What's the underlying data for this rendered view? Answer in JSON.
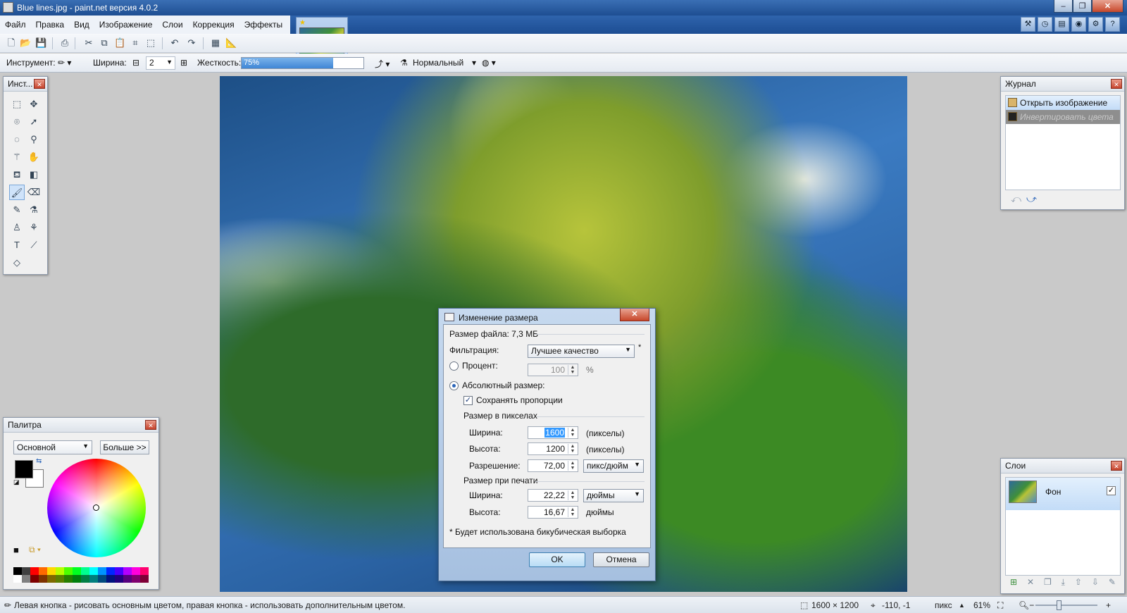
{
  "window": {
    "title": "Blue lines.jpg - paint.net версия 4.0.2",
    "controls": [
      "–",
      "❐",
      "✕"
    ]
  },
  "menu": [
    "Файл",
    "Правка",
    "Вид",
    "Изображение",
    "Слои",
    "Коррекция",
    "Эффекты"
  ],
  "toolbar": {
    "tool_label": "Инструмент:",
    "width_label": "Ширина:",
    "width_value": "2",
    "hardness_label": "Жесткость:",
    "hardness_value": "75%",
    "hardness_fraction": 0.75,
    "blend_mode": "Нормальный"
  },
  "tools_panel": {
    "title": "Инст...",
    "tools": [
      "rectangle-select-icon",
      "move-selection-icon",
      "lasso-icon",
      "move-selected-icon",
      "ellipse-select-icon",
      "zoom-icon",
      "magic-wand-icon",
      "pan-icon",
      "paint-bucket-icon",
      "gradient-icon",
      "paintbrush-icon",
      "eraser-icon",
      "pencil-icon",
      "color-picker-icon",
      "clone-stamp-icon",
      "recolor-icon",
      "text-icon",
      "line-curve-icon",
      "shapes-icon"
    ],
    "active_index": 10
  },
  "history": {
    "title": "Журнал",
    "items": [
      {
        "label": "Открыть изображение",
        "state": "selected"
      },
      {
        "label": "Инвертировать цвета",
        "state": "undone"
      }
    ]
  },
  "layers": {
    "title": "Слои",
    "items": [
      {
        "name": "Фон",
        "visible": true
      }
    ]
  },
  "palette": {
    "title": "Палитра",
    "mode": "Основной",
    "more_button": "Больше >>",
    "primary_color": "#000000",
    "secondary_color": "#ffffff",
    "colors": [
      "#000000",
      "#404040",
      "#ff0000",
      "#ff6a00",
      "#ffd800",
      "#b6ff00",
      "#4cff00",
      "#00ff21",
      "#00ff90",
      "#00ffff",
      "#0094ff",
      "#0026ff",
      "#4800ff",
      "#b200ff",
      "#ff00dc",
      "#ff006e",
      "#ffffff",
      "#808080",
      "#7f0000",
      "#7f3300",
      "#7f6a00",
      "#5b7f00",
      "#267f00",
      "#007f0e",
      "#007f46",
      "#007f7f",
      "#004a7f",
      "#00137f",
      "#21007f",
      "#57007f",
      "#7f006e",
      "#7f0037"
    ]
  },
  "dialog": {
    "title": "Изменение размера",
    "file_size": "Размер файла: 7,3 МБ",
    "filter_label": "Фильтрация:",
    "filter_value": "Лучшее качество",
    "filter_mark": "*",
    "percent_label": "Процент:",
    "percent_value": "100",
    "percent_unit": "%",
    "absolute_label": "Абсолютный размер:",
    "keep_ratio_label": "Сохранять пропорции",
    "pixel_size_label": "Размер в пикселах",
    "width_label": "Ширина:",
    "width_px": "1600",
    "width_px_unit": "(пикселы)",
    "height_label": "Высота:",
    "height_px": "1200",
    "height_px_unit": "(пикселы)",
    "resolution_label": "Разрешение:",
    "resolution_value": "72,00",
    "resolution_unit": "пикс/дюйм",
    "print_size_label": "Размер при печати",
    "print_width_label": "Ширина:",
    "print_width": "22,22",
    "print_unit": "дюймы",
    "print_height_label": "Высота:",
    "print_height": "16,67",
    "print_height_unit": "дюймы",
    "note": "* Будет использована бикубическая выборка",
    "ok": "OK",
    "cancel": "Отмена"
  },
  "status": {
    "hint": "Левая кнопка - рисовать основным цветом, правая кнопка - использовать дополнительным цветом.",
    "image_size": "1600 × 1200",
    "cursor": "-110, -1",
    "units": "пикс",
    "zoom": "61%"
  }
}
